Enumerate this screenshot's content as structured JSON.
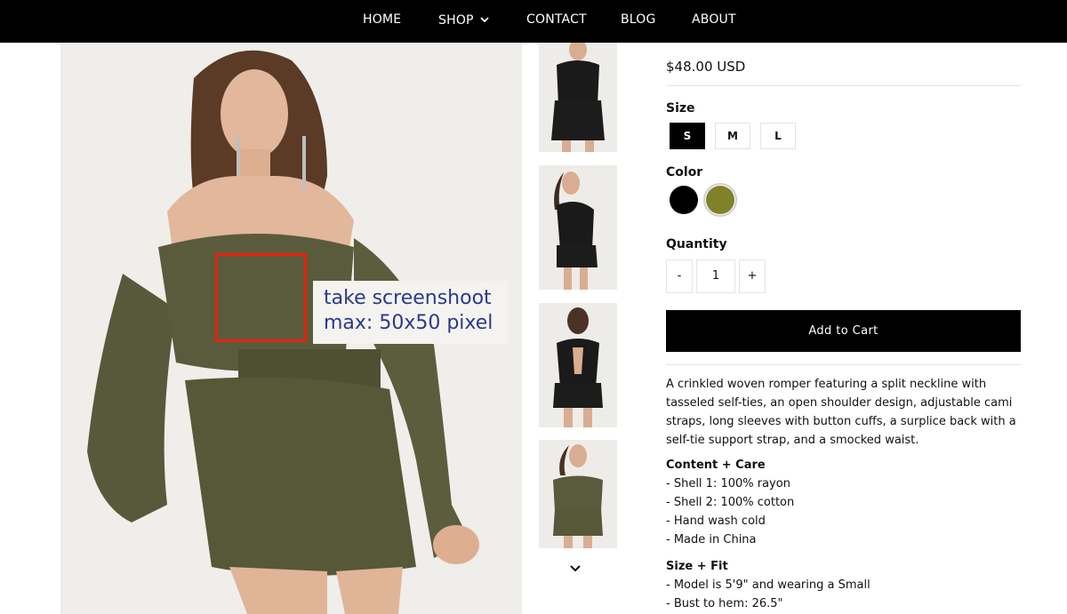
{
  "nav": {
    "items": [
      "HOME",
      "SHOP",
      "CONTACT",
      "BLOG",
      "ABOUT"
    ]
  },
  "callout": {
    "line1": "take screenshoot",
    "line2": "max: 50x50 pixel",
    "box_color": "#e8210f",
    "text_color": "#2a3a8c"
  },
  "product": {
    "price": "$48.00 USD",
    "size_label": "Size",
    "sizes": [
      "S",
      "M",
      "L"
    ],
    "selected_size": "S",
    "color_label": "Color",
    "colors": [
      "#000000",
      "#7f822a"
    ],
    "selected_color": "#7f822a",
    "quantity_label": "Quantity",
    "quantity_minus": "-",
    "quantity_value": "1",
    "quantity_plus": "+",
    "add_to_cart": "Add to Cart",
    "description": "A crinkled woven romper featuring a split neckline with tasseled self-ties, an open shoulder design, adjustable cami straps, long sleeves with button cuffs, a surplice back with a self-tie support strap, and a smocked waist.",
    "content_care_heading": "Content + Care",
    "content_care": [
      "- Shell 1: 100% rayon",
      "- Shell 2: 100% cotton",
      "- Hand wash cold",
      "- Made in China"
    ],
    "size_fit_heading": "Size + Fit",
    "size_fit": [
      "- Model is 5'9\" and wearing a Small",
      "- Bust to hem: 26.5\""
    ]
  },
  "colors": {
    "nav_bg": "#000000",
    "romper_olive": "#5a5a3c",
    "black_romper": "#1a1a1a"
  }
}
